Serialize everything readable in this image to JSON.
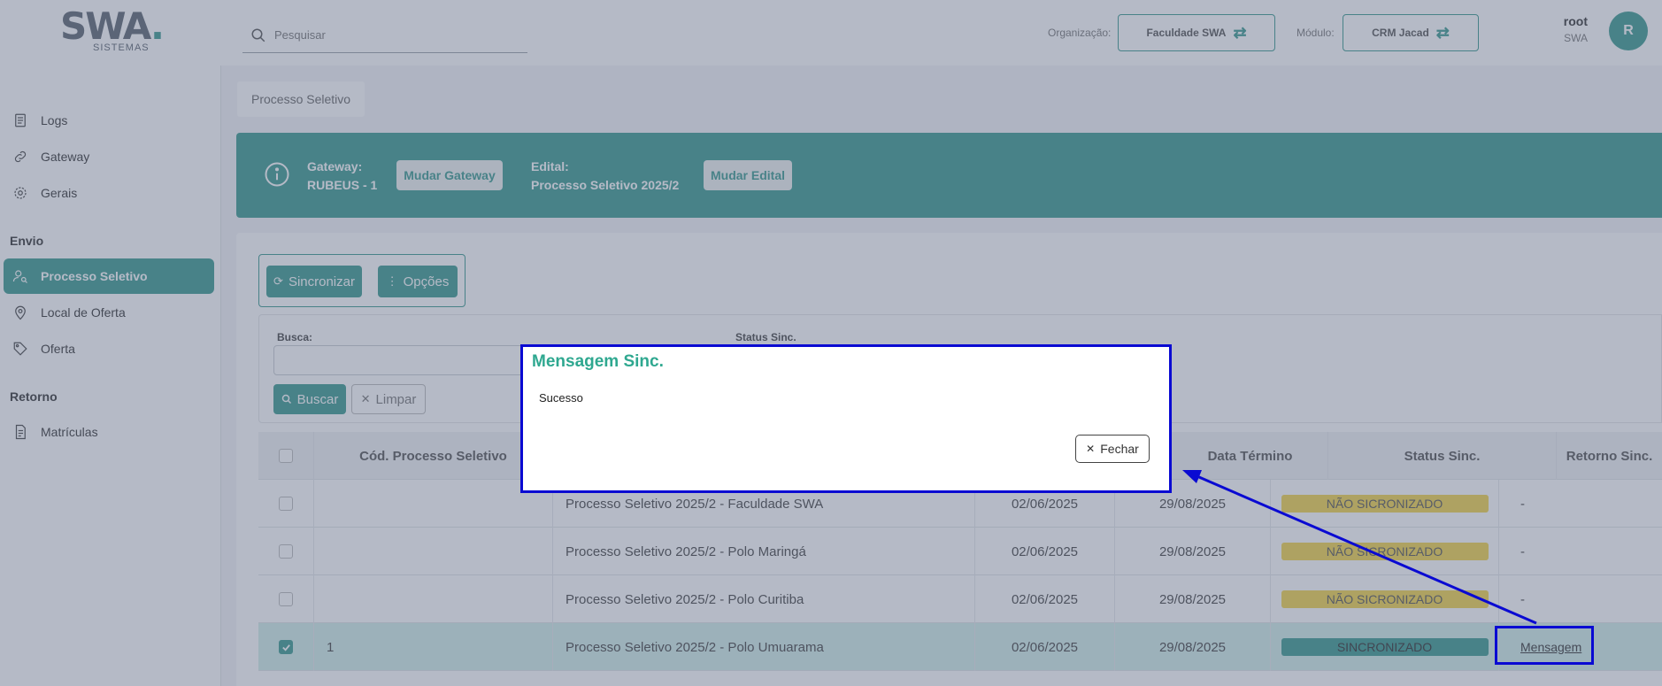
{
  "header": {
    "logo_text": "SWA",
    "logo_sub": "SISTEMAS",
    "search_placeholder": "Pesquisar",
    "org_label": "Organização:",
    "org_value": "Faculdade SWA",
    "module_label": "Módulo:",
    "module_value": "CRM Jacad",
    "user_name": "root",
    "user_org": "SWA",
    "avatar_letter": "R"
  },
  "sidebar": {
    "items": [
      {
        "label": "Logs",
        "icon": "logs-icon"
      },
      {
        "label": "Gateway",
        "icon": "link-icon"
      },
      {
        "label": "Gerais",
        "icon": "gear-icon"
      }
    ],
    "section_envio": "Envio",
    "envio_items": [
      {
        "label": "Processo Seletivo",
        "icon": "user-search-icon",
        "active": true
      },
      {
        "label": "Local de Oferta",
        "icon": "location-pin-icon"
      },
      {
        "label": "Oferta",
        "icon": "tag-icon"
      }
    ],
    "section_retorno": "Retorno",
    "retorno_items": [
      {
        "label": "Matrículas",
        "icon": "document-icon"
      }
    ]
  },
  "breadcrumb": "Processo Seletivo",
  "banner": {
    "gateway_label": "Gateway:",
    "gateway_value": "RUBEUS - 1",
    "mudar_gateway": "Mudar Gateway",
    "edital_label": "Edital:",
    "edital_value": "Processo Seletivo 2025/2",
    "mudar_edital": "Mudar Edital"
  },
  "toolbar": {
    "sincronizar": "Sincronizar",
    "opcoes": "Opções"
  },
  "filters": {
    "busca_label": "Busca:",
    "status_label": "Status Sinc.",
    "buscar": "Buscar",
    "limpar": "Limpar"
  },
  "table": {
    "headers": [
      "Cód. Processo Seletivo",
      "Data Término",
      "Status Sinc.",
      "Retorno Sinc."
    ],
    "rows": [
      {
        "codigo": "",
        "nome": "Processo Seletivo 2025/2 - Faculdade SWA",
        "inicio": "02/06/2025",
        "termino": "29/08/2025",
        "status": "NÃO SICRONIZADO",
        "retorno": "-",
        "checked": false
      },
      {
        "codigo": "",
        "nome": "Processo Seletivo 2025/2 - Polo Maringá",
        "inicio": "02/06/2025",
        "termino": "29/08/2025",
        "status": "NÃO SICRONIZADO",
        "retorno": "-",
        "checked": false
      },
      {
        "codigo": "",
        "nome": "Processo Seletivo 2025/2 - Polo Curitiba",
        "inicio": "02/06/2025",
        "termino": "29/08/2025",
        "status": "NÃO SICRONIZADO",
        "retorno": "-",
        "checked": false
      },
      {
        "codigo": "1",
        "nome": "Processo Seletivo 2025/2 - Polo Umuarama",
        "inicio": "02/06/2025",
        "termino": "29/08/2025",
        "status": "SINCRONIZADO",
        "retorno": "Mensagem",
        "checked": true
      }
    ]
  },
  "modal": {
    "title": "Mensagem Sinc.",
    "body": "Sucesso",
    "close": "Fechar"
  },
  "colors": {
    "accent": "#3a9a8f",
    "annotation": "#0a0ad2",
    "status_pending": "#f2d44a"
  }
}
